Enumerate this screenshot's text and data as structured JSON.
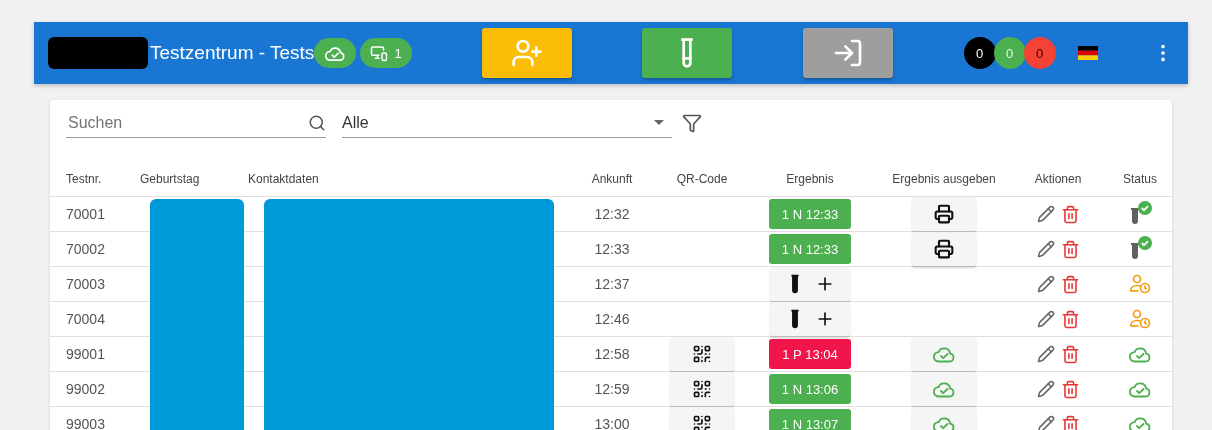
{
  "header": {
    "title": "Testzentrum - Tests",
    "device_count": "1",
    "counters": [
      {
        "value": "0",
        "color": "#000000"
      },
      {
        "value": "0",
        "color": "#4caf50"
      },
      {
        "value": "0",
        "color": "#f44336"
      }
    ]
  },
  "toolbar": {
    "search_placeholder": "Suchen",
    "filter_value": "Alle"
  },
  "table": {
    "columns": [
      "Testnr.",
      "Geburtstag",
      "Kontaktdaten",
      "Ankunft",
      "QR-Code",
      "Ergebnis",
      "Ergebnis ausgeben",
      "Aktionen",
      "Status"
    ],
    "rows": [
      {
        "testnr": "70001",
        "arrival": "12:32",
        "qr": false,
        "result": {
          "kind": "result",
          "text": "1 N 12:33",
          "positive": false
        },
        "output": {
          "kind": "print"
        },
        "status": {
          "kind": "tested"
        }
      },
      {
        "testnr": "70002",
        "arrival": "12:33",
        "qr": false,
        "result": {
          "kind": "result",
          "text": "1 N 12:33",
          "positive": false
        },
        "output": {
          "kind": "print"
        },
        "status": {
          "kind": "tested"
        }
      },
      {
        "testnr": "70003",
        "arrival": "12:37",
        "qr": false,
        "result": {
          "kind": "add"
        },
        "status": {
          "kind": "waiting"
        }
      },
      {
        "testnr": "70004",
        "arrival": "12:46",
        "qr": false,
        "result": {
          "kind": "add"
        },
        "status": {
          "kind": "waiting"
        }
      },
      {
        "testnr": "99001",
        "arrival": "12:58",
        "qr": true,
        "result": {
          "kind": "result",
          "text": "1 P 13:04",
          "positive": true
        },
        "output": {
          "kind": "synced"
        },
        "status": {
          "kind": "synced"
        }
      },
      {
        "testnr": "99002",
        "arrival": "12:59",
        "qr": true,
        "result": {
          "kind": "result",
          "text": "1 N 13:06",
          "positive": false
        },
        "output": {
          "kind": "synced"
        },
        "status": {
          "kind": "synced"
        }
      },
      {
        "testnr": "99003",
        "arrival": "13:00",
        "qr": true,
        "result": {
          "kind": "result",
          "text": "1 N 13:07",
          "positive": false
        },
        "output": {
          "kind": "synced"
        },
        "status": {
          "kind": "synced"
        }
      }
    ]
  }
}
